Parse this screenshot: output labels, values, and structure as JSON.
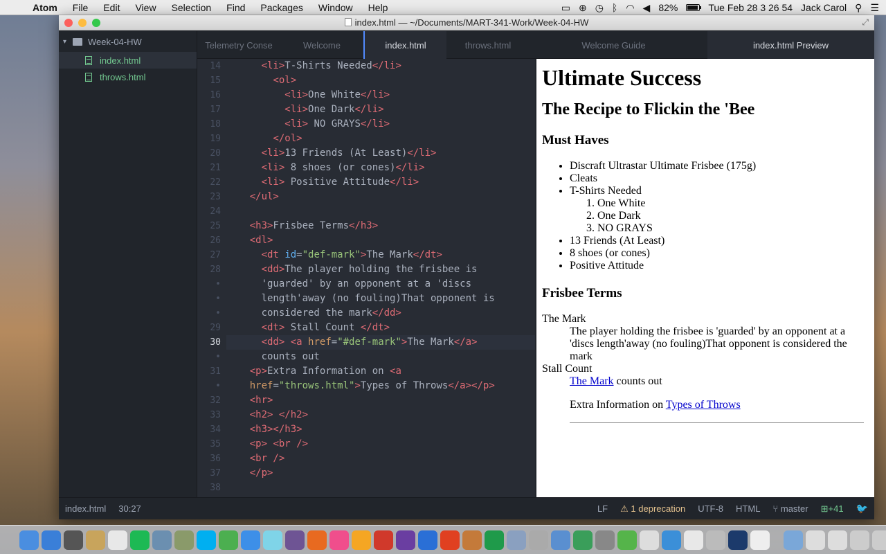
{
  "menubar": {
    "app": "Atom",
    "menus": [
      "File",
      "Edit",
      "View",
      "Selection",
      "Find",
      "Packages",
      "Window",
      "Help"
    ],
    "battery": "82%",
    "clock": "Tue Feb 28  3 26 54",
    "user": "Jack Carol"
  },
  "window": {
    "title": "index.html — ~/Documents/MART-341-Work/Week-04-HW"
  },
  "sidebar": {
    "project": "Week-04-HW",
    "files": [
      {
        "name": "index.html",
        "selected": true
      },
      {
        "name": "throws.html",
        "selected": false
      }
    ]
  },
  "tabs": [
    {
      "label": "Telemetry Conse",
      "active": false
    },
    {
      "label": "Welcome",
      "active": false
    },
    {
      "label": "index.html",
      "active": true
    },
    {
      "label": "throws.html",
      "active": false
    },
    {
      "label": "Welcome Guide",
      "active": false
    },
    {
      "label": "index.html Preview",
      "active": true
    }
  ],
  "editor": {
    "current_line": "30",
    "lines": [
      {
        "n": "14",
        "html": "      <span class='t'>&lt;li&gt;</span>T-Shirts Needed<span class='t'>&lt;/li&gt;</span>"
      },
      {
        "n": "15",
        "html": "        <span class='t'>&lt;ol&gt;</span>"
      },
      {
        "n": "16",
        "html": "          <span class='t'>&lt;li&gt;</span>One White<span class='t'>&lt;/li&gt;</span>"
      },
      {
        "n": "17",
        "html": "          <span class='t'>&lt;li&gt;</span>One Dark<span class='t'>&lt;/li&gt;</span>"
      },
      {
        "n": "18",
        "html": "          <span class='t'>&lt;li&gt;</span> NO GRAYS<span class='t'>&lt;/li&gt;</span>"
      },
      {
        "n": "19",
        "html": "        <span class='t'>&lt;/ol&gt;</span>"
      },
      {
        "n": "20",
        "html": "      <span class='t'>&lt;li&gt;</span>13 Friends (At Least)<span class='t'>&lt;/li&gt;</span>"
      },
      {
        "n": "21",
        "html": "      <span class='t'>&lt;li&gt;</span> 8 shoes (or cones)<span class='t'>&lt;/li&gt;</span>"
      },
      {
        "n": "22",
        "html": "      <span class='t'>&lt;li&gt;</span> Positive Attitude<span class='t'>&lt;/li&gt;</span>"
      },
      {
        "n": "23",
        "html": "    <span class='t'>&lt;/ul&gt;</span>"
      },
      {
        "n": "24",
        "html": ""
      },
      {
        "n": "25",
        "html": "    <span class='t'>&lt;h3&gt;</span>Frisbee Terms<span class='t'>&lt;/h3&gt;</span>"
      },
      {
        "n": "26",
        "html": "    <span class='t'>&lt;dl&gt;</span>"
      },
      {
        "n": "27",
        "html": "      <span class='t'>&lt;dt</span> <span class='at'>id</span>=<span class='s'>\"def-mark\"</span><span class='t'>&gt;</span>The Mark<span class='t'>&lt;/dt&gt;</span>"
      },
      {
        "n": "28",
        "html": "      <span class='t'>&lt;dd&gt;</span>The player holding the frisbee is"
      },
      {
        "n": "•",
        "html": "      'guarded' by an opponent at a 'discs"
      },
      {
        "n": "•",
        "html": "      length'away (no fouling)That opponent is"
      },
      {
        "n": "•",
        "html": "      considered the mark<span class='t'>&lt;/dd&gt;</span>"
      },
      {
        "n": "29",
        "html": "      <span class='t'>&lt;dt&gt;</span> Stall Count <span class='t'>&lt;/dt&gt;</span>"
      },
      {
        "n": "30",
        "html": "      <span class='t'>&lt;dd&gt;</span> <span class='t'>&lt;a</span> <span class='a'>href</span>=<span class='s'>\"#def-mark\"</span><span class='t'>&gt;</span>The Mark<span class='t'>&lt;/a&gt;</span>"
      },
      {
        "n": "•",
        "html": "      counts out"
      },
      {
        "n": "31",
        "html": "    <span class='t'>&lt;p&gt;</span>Extra Information on <span class='t'>&lt;a</span>"
      },
      {
        "n": "•",
        "html": "    <span class='a'>href</span>=<span class='s'>\"throws.html\"</span><span class='t'>&gt;</span>Types of Throws<span class='t'>&lt;/a&gt;&lt;/p&gt;</span>"
      },
      {
        "n": "32",
        "html": "    <span class='t'>&lt;hr&gt;</span>"
      },
      {
        "n": "33",
        "html": "    <span class='t'>&lt;h2&gt;</span> <span class='t'>&lt;/h2&gt;</span>"
      },
      {
        "n": "34",
        "html": "    <span class='t'>&lt;h3&gt;&lt;/h3&gt;</span>"
      },
      {
        "n": "35",
        "html": "    <span class='t'>&lt;p&gt;</span> <span class='t'>&lt;br /&gt;</span>"
      },
      {
        "n": "36",
        "html": "    <span class='t'>&lt;br /&gt;</span>"
      },
      {
        "n": "37",
        "html": "    <span class='t'>&lt;/p&gt;</span>"
      },
      {
        "n": "38",
        "html": ""
      }
    ]
  },
  "preview": {
    "h1": "Ultimate Success",
    "h2": "The Recipe to Flickin the 'Bee",
    "h3_musthaves": "Must Haves",
    "items": [
      "Discraft Ultrastar Ultimate Frisbee (175g)",
      "Cleats",
      "T-Shirts Needed"
    ],
    "subitems": [
      "One White",
      "One Dark",
      "NO GRAYS"
    ],
    "items2": [
      "13 Friends (At Least)",
      "8 shoes (or cones)",
      "Positive Attitude"
    ],
    "h3_terms": "Frisbee Terms",
    "dt1": "The Mark",
    "dd1": "The player holding the frisbee is 'guarded' by an opponent at a 'discs length'away (no fouling)That opponent is considered the mark",
    "dt2": "Stall Count",
    "dd2_link": "The Mark",
    "dd2_text": " counts out",
    "p_text": "Extra Information on ",
    "p_link": "Types of Throws"
  },
  "status": {
    "file": "index.html",
    "cursor": "30:27",
    "line_ending": "LF",
    "deprecation": "1 deprecation",
    "encoding": "UTF-8",
    "grammar": "HTML",
    "branch": "master",
    "diff": "+41"
  },
  "dock": {
    "colors": [
      "#4a8ee0",
      "#3a7fd8",
      "#555",
      "#c8a45c",
      "#e8e8e8",
      "#1db954",
      "#6b8fb0",
      "#8a9a6a",
      "#00aff0",
      "#4caf50",
      "#3d8fe8",
      "#7fd4e8",
      "#6e5494",
      "#e86a20",
      "#f04e8c",
      "#f5a623",
      "#d0392b",
      "#6a3ea1",
      "#2a6fd6",
      "#e04020",
      "#c47a3a",
      "#1f9a4a",
      "#8aa0c0",
      "#aaa",
      "#5a8fd0",
      "#3a9e5a",
      "#888",
      "#55b44a",
      "#ddd",
      "#3b8fd8",
      "#e8e8e8",
      "#bbb",
      "#1c3a6b",
      "#eee",
      "#7aa7d8",
      "#ddd",
      "#ddd",
      "#ccc",
      "#ccc",
      "#999"
    ]
  }
}
